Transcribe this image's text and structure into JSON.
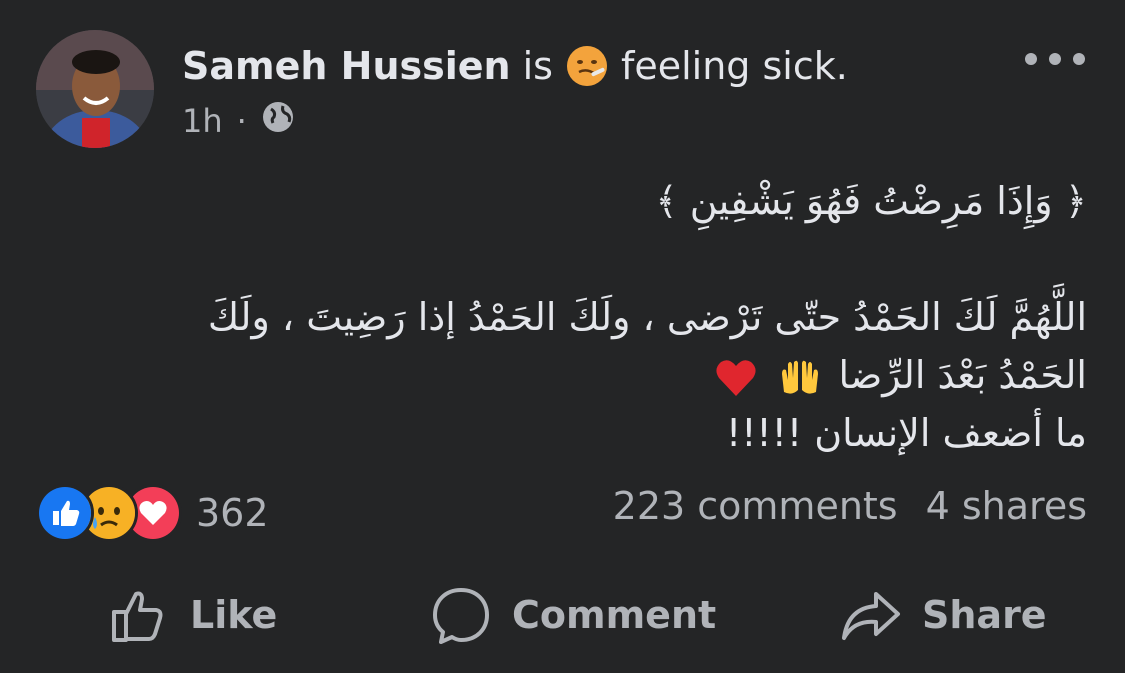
{
  "post": {
    "author": "Sameh Hussien",
    "feeling_prefix": "is",
    "feeling_emoji": "sick-face-icon",
    "feeling_text": "feeling sick.",
    "time": "1h",
    "separator": "·",
    "audience_icon": "globe-icon",
    "more_icon": "more-options-icon",
    "verse": "﴿ وَإِذَا مَرِضْتُ فَهُوَ يَشْفِينِ ﴾",
    "line1": "اللَّهُمَّ لَكَ الحَمْدُ حتّى تَرْضى ، ولَكَ الحَمْدُ إذا رَضِيتَ ، ولَكَ",
    "line2": "الحَمْدُ بَعْدَ الرِّضا",
    "line2_emojis": [
      "raised-hands-icon",
      "red-heart-icon"
    ],
    "line3": "ما أضعف الإنسان !!!!!"
  },
  "reactions": {
    "icons": [
      "like-reaction-icon",
      "sad-reaction-icon",
      "love-reaction-icon"
    ],
    "count": "362"
  },
  "stats": {
    "comments": "223 comments",
    "shares": "4 shares"
  },
  "actions": {
    "like": "Like",
    "comment": "Comment",
    "share": "Share"
  },
  "colors": {
    "background": "#242526",
    "primary_text": "#e4e6eb",
    "secondary_text": "#b0b3b8",
    "like_blue": "#1877f2",
    "love_red": "#f33e58",
    "sad_yellow": "#f7b125"
  }
}
